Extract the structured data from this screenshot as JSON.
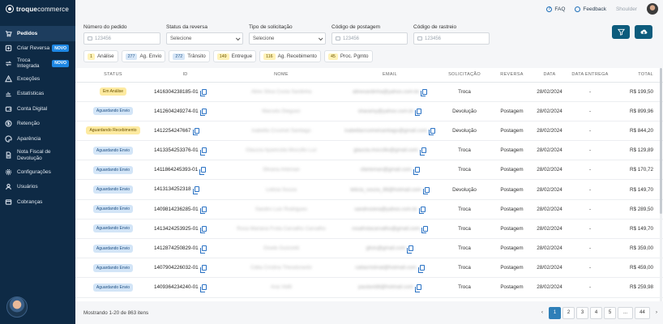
{
  "brand": {
    "name_bold": "troque",
    "name_light": "commerce"
  },
  "topbar": {
    "faq": "FAQ",
    "feedback": "Feedback",
    "user_name": "Shoulder"
  },
  "sidebar": {
    "items": [
      {
        "label": "Pedidos",
        "icon": "cart-icon",
        "active": true
      },
      {
        "label": "Criar Reversa",
        "icon": "plus-icon",
        "badge": "NOVO"
      },
      {
        "label": "Troca Integrada",
        "icon": "swap-icon",
        "badge": "NOVO"
      },
      {
        "label": "Exceções",
        "icon": "alert-icon"
      },
      {
        "label": "Estatísticas",
        "icon": "chart-icon"
      },
      {
        "label": "Conta Digital",
        "icon": "wallet-icon"
      },
      {
        "label": "Retenção",
        "icon": "dollar-icon"
      },
      {
        "label": "Aparência",
        "icon": "palette-icon"
      },
      {
        "label": "Nota Fiscal de Devolução",
        "icon": "document-icon"
      },
      {
        "label": "Configurações",
        "icon": "gear-icon"
      },
      {
        "label": "Usuários",
        "icon": "user-icon"
      },
      {
        "label": "Cobranças",
        "icon": "billing-icon"
      }
    ]
  },
  "filters": {
    "order_number": {
      "label": "Número do pedido",
      "placeholder": "123456"
    },
    "reverse_status": {
      "label": "Status da reversa",
      "value": "Selecione"
    },
    "request_type": {
      "label": "Tipo de solicitação",
      "value": "Selecione"
    },
    "postage_code": {
      "label": "Código de postagem",
      "placeholder": "123456"
    },
    "tracking_code": {
      "label": "Código de rastreio",
      "placeholder": "123456"
    }
  },
  "chips": [
    {
      "count": "1",
      "label": "Análise",
      "color": "yellow"
    },
    {
      "count": "277",
      "label": "Ag. Envio",
      "color": "blue"
    },
    {
      "count": "272",
      "label": "Trânsito",
      "color": "blue"
    },
    {
      "count": "149",
      "label": "Entregue",
      "color": "yellow"
    },
    {
      "count": "116",
      "label": "Ag. Recebimento",
      "color": "yellow"
    },
    {
      "count": "45",
      "label": "Proc. Pgmto",
      "color": "yellow"
    }
  ],
  "table": {
    "headers": {
      "status": "Status",
      "id": "ID",
      "name": "Nome",
      "email": "Email",
      "request": "Solicitação",
      "reverse": "Reversa",
      "date": "Data",
      "delivery": "Data Entrega",
      "total": "Total"
    },
    "rows": [
      {
        "status": "Em Análise",
        "status_color": "yellow",
        "id": "1416304238185-01",
        "name": "Aline Silva Costa Sardinha",
        "email": "alinesardinha@yahoo.com.br",
        "request": "Troca",
        "reverse": "",
        "date": "28/02/2024",
        "delivery": "-",
        "total": "R$ 199,50"
      },
      {
        "status": "Aguardando Envio",
        "status_color": "blue",
        "id": "1412604249274-01",
        "name": "Marcelo Dieguez",
        "email": "sharamy@yahoo.com.br",
        "request": "Devolução",
        "reverse": "Postagem",
        "date": "28/02/2024",
        "delivery": "-",
        "total": "R$ 899,96"
      },
      {
        "status": "Aguardando Recebimento",
        "status_color": "yellow",
        "id": "1412254247667",
        "name": "Isabella Cruvinel Santiago",
        "email": "isabellacruvinelsantiago@gmail.com",
        "request": "Devolução",
        "reverse": "Postagem",
        "date": "28/02/2024",
        "delivery": "-",
        "total": "R$ 844,20"
      },
      {
        "status": "Aguardando Envio",
        "status_color": "blue",
        "id": "1413354253376-01",
        "name": "Glaucia Aparecida Moccillo Luz",
        "email": "glaucia.moccillo@gmail.com",
        "request": "Troca",
        "reverse": "Postagem",
        "date": "28/02/2024",
        "delivery": "-",
        "total": "R$ 129,89"
      },
      {
        "status": "Aguardando Envio",
        "status_color": "blue",
        "id": "1411864245393-01",
        "name": "Silvana Arteman",
        "email": "sfarteman@gmail.com",
        "request": "Troca",
        "reverse": "Postagem",
        "date": "28/02/2024",
        "delivery": "-",
        "total": "R$ 170,72"
      },
      {
        "status": "Aguardando Envio",
        "status_color": "blue",
        "id": "1413134252318",
        "name": "Leticia Souza",
        "email": "leticia_souza_88@hotmail.com",
        "request": "Devolução",
        "reverse": "Postagem",
        "date": "28/02/2024",
        "delivery": "-",
        "total": "R$ 149,70"
      },
      {
        "status": "Aguardando Envio",
        "status_color": "blue",
        "id": "1409814236285-01",
        "name": "Sandro Luiz Rodrigues",
        "email": "sandrosiera@yahoo.com.br",
        "request": "Troca",
        "reverse": "Postagem",
        "date": "28/02/2024",
        "delivery": "-",
        "total": "R$ 289,50"
      },
      {
        "status": "Aguardando Envio",
        "status_color": "blue",
        "id": "1413424253925-01",
        "name": "Rosa Mariana Frota Carvalho Carvalho",
        "email": "rosafrotacarvalho@gmail.com",
        "request": "Troca",
        "reverse": "Postagem",
        "date": "28/02/2024",
        "delivery": "-",
        "total": "R$ 149,70"
      },
      {
        "status": "Aguardando Envio",
        "status_color": "blue",
        "id": "1412874250829-01",
        "name": "Gisele Guizzetti",
        "email": "gfuts@gmail.com",
        "request": "Troca",
        "reverse": "Postagem",
        "date": "28/02/2024",
        "delivery": "-",
        "total": "R$ 359,00"
      },
      {
        "status": "Aguardando Envio",
        "status_color": "blue",
        "id": "1407904226032-01",
        "name": "Cátia Cristina Theodoravitz",
        "email": "catiacristinat@hotmail.com",
        "request": "Troca",
        "reverse": "Postagem",
        "date": "28/02/2024",
        "delivery": "-",
        "total": "R$ 459,00"
      },
      {
        "status": "Aguardando Envio",
        "status_color": "blue",
        "id": "1409364234240-01",
        "name": "Ana Vidili",
        "email": "paulavidili@hotmail.com",
        "request": "Troca",
        "reverse": "Postagem",
        "date": "28/02/2024",
        "delivery": "-",
        "total": "R$ 259,98"
      }
    ]
  },
  "footer": {
    "summary": "Mostrando 1-20 de 863 itens"
  },
  "pagination": {
    "pages": [
      "1",
      "2",
      "3",
      "4",
      "5",
      "...",
      "44"
    ],
    "active": "1",
    "prev": "‹",
    "next": "›"
  },
  "colors": {
    "sidebar": "#0e2a45",
    "accent": "#0d5c7d",
    "active_page": "#2e7fb8"
  }
}
